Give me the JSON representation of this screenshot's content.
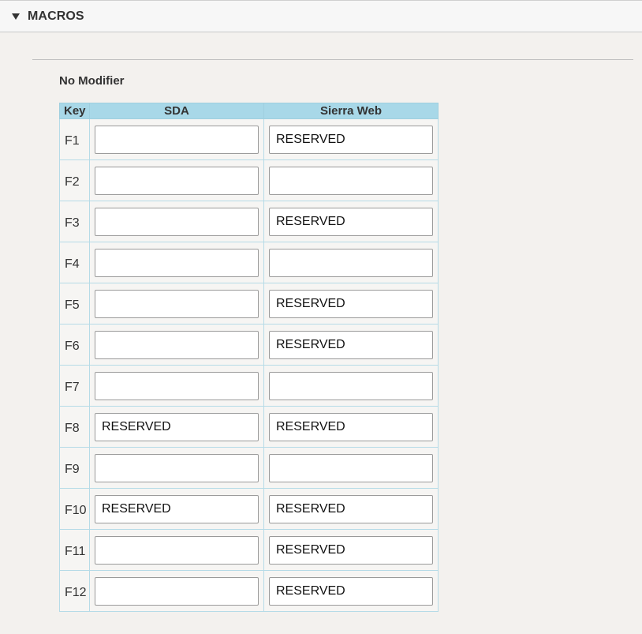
{
  "section": {
    "title": "MACROS"
  },
  "group": {
    "title": "No Modifier"
  },
  "table": {
    "headers": {
      "key": "Key",
      "sda": "SDA",
      "web": "Sierra Web"
    },
    "rows": [
      {
        "key": "F1",
        "sda": "",
        "web": "RESERVED"
      },
      {
        "key": "F2",
        "sda": "",
        "web": ""
      },
      {
        "key": "F3",
        "sda": "",
        "web": "RESERVED"
      },
      {
        "key": "F4",
        "sda": "",
        "web": ""
      },
      {
        "key": "F5",
        "sda": "",
        "web": "RESERVED"
      },
      {
        "key": "F6",
        "sda": "",
        "web": "RESERVED"
      },
      {
        "key": "F7",
        "sda": "",
        "web": ""
      },
      {
        "key": "F8",
        "sda": "RESERVED",
        "web": "RESERVED"
      },
      {
        "key": "F9",
        "sda": "",
        "web": ""
      },
      {
        "key": "F10",
        "sda": "RESERVED",
        "web": "RESERVED"
      },
      {
        "key": "F11",
        "sda": "",
        "web": "RESERVED"
      },
      {
        "key": "F12",
        "sda": "",
        "web": "RESERVED"
      }
    ]
  },
  "colors": {
    "header_bg": "#a8d8e8",
    "page_bg": "#f3f1ee",
    "cell_border": "#b6dbe7"
  },
  "icons": {
    "collapse": "triangle-down-icon"
  }
}
